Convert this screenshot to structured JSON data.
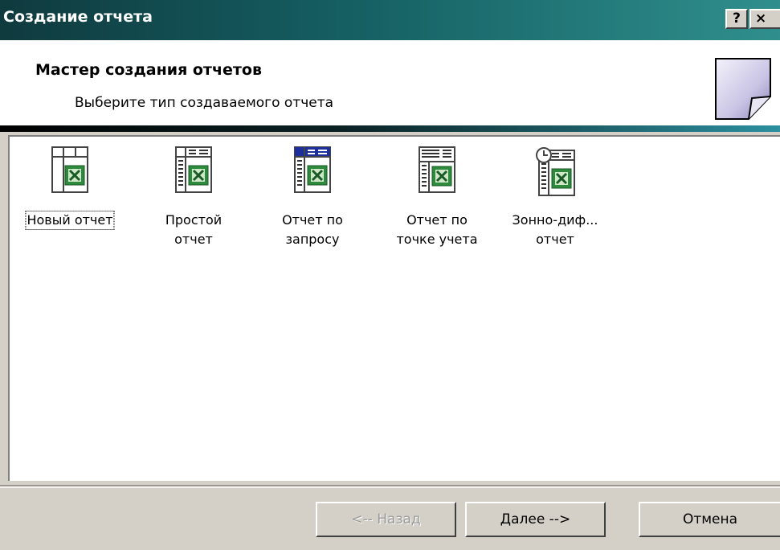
{
  "window": {
    "title": "Создание отчета",
    "help_label": "?",
    "close_label": "×"
  },
  "header": {
    "title": "Мастер создания отчетов",
    "subtitle": "Выберите тип создаваемого отчета",
    "icon": "report-page-icon"
  },
  "items": [
    {
      "label": "Новый отчет",
      "icon": "new-report-icon",
      "selected": true
    },
    {
      "label": "Простой\nотчет",
      "icon": "simple-report-icon"
    },
    {
      "label": "Отчет по\nзапросу",
      "icon": "query-report-icon"
    },
    {
      "label": "Отчет по\nточке учета",
      "icon": "metering-point-report-icon"
    },
    {
      "label": "Зонно-диф...\nотчет",
      "icon": "zone-report-icon"
    }
  ],
  "buttons": {
    "back": "<-- Назад",
    "next": "Далее -->",
    "cancel": "Отмена"
  },
  "colors": {
    "title_bar": "#155f63",
    "window_bg": "#d4d0c8",
    "excel_green": "#2e8b3e"
  }
}
